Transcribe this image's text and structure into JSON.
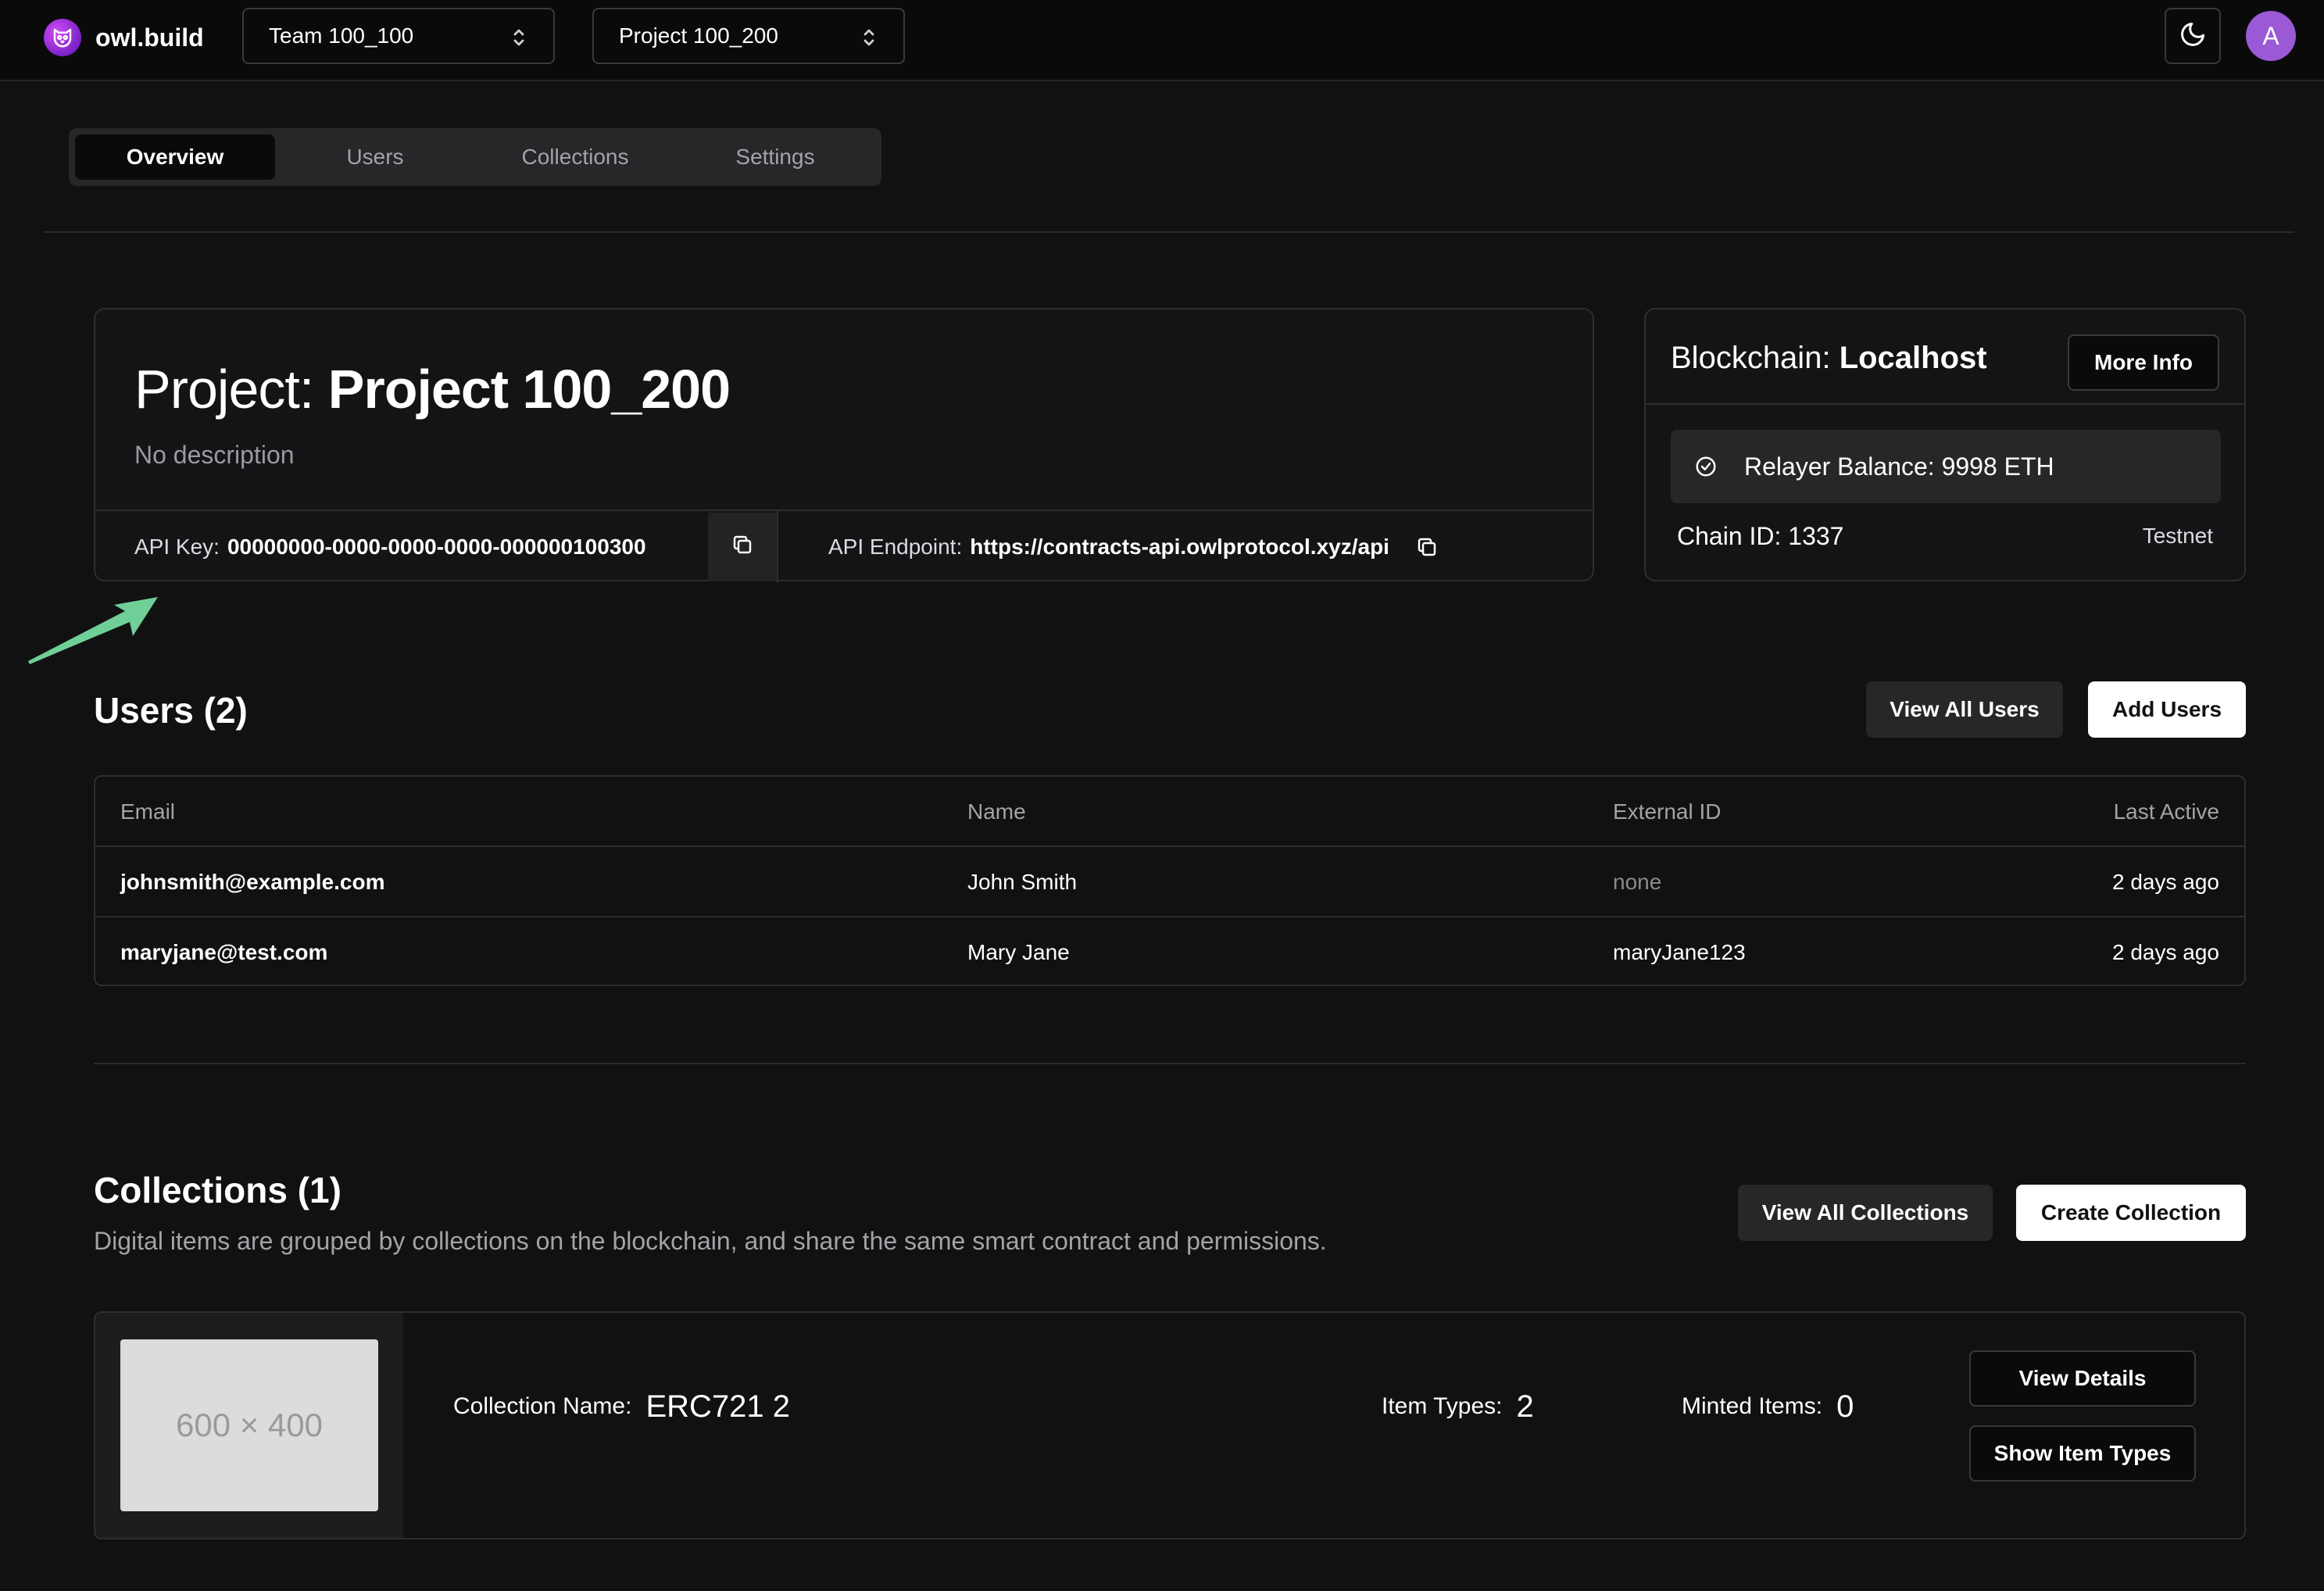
{
  "brand": {
    "name": "owl.build",
    "logo_icon": "owl-icon"
  },
  "header": {
    "team_selector": "Team 100_100",
    "project_selector": "Project 100_200",
    "theme_icon": "moon-icon",
    "avatar_initial": "A"
  },
  "tabs": [
    {
      "label": "Overview",
      "active": true
    },
    {
      "label": "Users",
      "active": false
    },
    {
      "label": "Collections",
      "active": false
    },
    {
      "label": "Settings",
      "active": false
    }
  ],
  "project": {
    "label": "Project:",
    "name": "Project 100_200",
    "description": "No description",
    "api_key_label": "API Key:",
    "api_key": "00000000-0000-0000-0000-000000100300",
    "api_endpoint_label": "API Endpoint:",
    "api_endpoint": "https://contracts-api.owlprotocol.xyz/api"
  },
  "blockchain": {
    "label": "Blockchain:",
    "name": "Localhost",
    "more_info": "More Info",
    "relayer": "Relayer Balance: 9998 ETH",
    "chain_id": "Chain ID: 1337",
    "network": "Testnet"
  },
  "users": {
    "title": "Users (2)",
    "view_all": "View All Users",
    "add": "Add Users",
    "columns": [
      "Email",
      "Name",
      "External ID",
      "Last Active"
    ],
    "rows": [
      {
        "email": "johnsmith@example.com",
        "name": "John Smith",
        "external_id": "none",
        "last_active": "2 days ago"
      },
      {
        "email": "maryjane@test.com",
        "name": "Mary Jane",
        "external_id": "maryJane123",
        "last_active": "2 days ago"
      }
    ]
  },
  "collections": {
    "title": "Collections (1)",
    "subtitle": "Digital items are grouped by collections on the blockchain, and share the same smart contract and permissions.",
    "view_all": "View All Collections",
    "create": "Create Collection",
    "items": [
      {
        "thumbnail_text": "600 × 400",
        "name_label": "Collection Name:",
        "name": "ERC721 2",
        "item_types_label": "Item Types:",
        "item_types": "2",
        "minted_label": "Minted Items:",
        "minted": "0",
        "view_details": "View Details",
        "show_item_types": "Show Item Types"
      }
    ]
  },
  "colors": {
    "accent_arrow": "#6fcf97",
    "brand_purple": "#9b59d6"
  }
}
